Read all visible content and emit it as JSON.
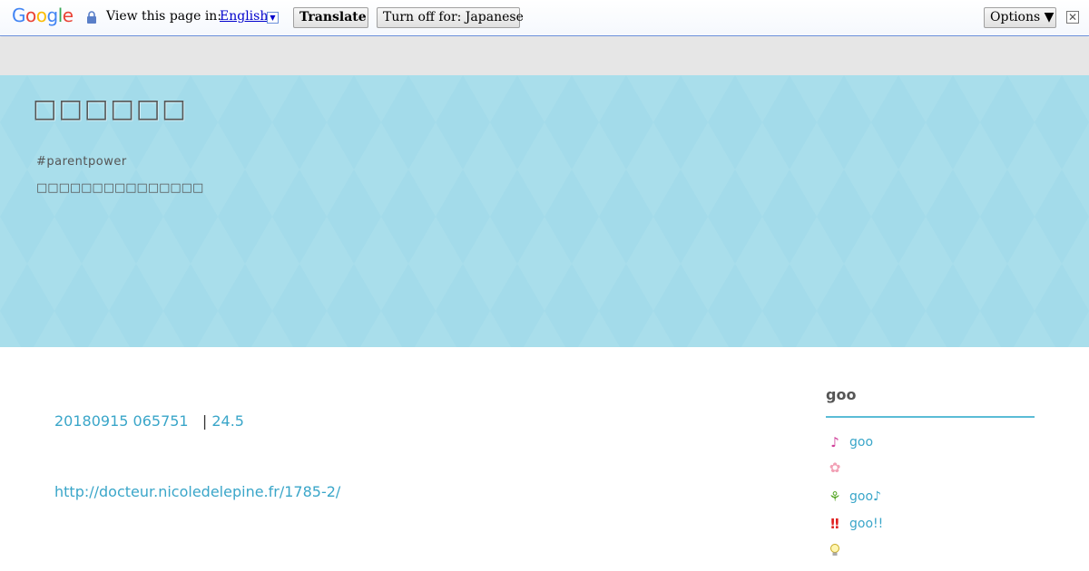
{
  "translate_bar": {
    "logo": "Google",
    "view_text": "View this page in:",
    "language": "English",
    "translate_label": "Translate",
    "turn_off_label": "Turn off for: Japanese",
    "options_label": "Options ▼",
    "close_glyph": "✕"
  },
  "header": {
    "title": "□□□□□□",
    "tag": "#parentpower",
    "description": "□□□□□□□□□□□□□□□"
  },
  "post": {
    "date": "20180915 065751",
    "separator": "|",
    "category": "24.5",
    "link": "http://docteur.nicoledelepine.fr/1785-2/"
  },
  "sidebar": {
    "title": "goo",
    "items": [
      {
        "icon": "music-note-icon",
        "glyph": "♪",
        "color": "#d0409a",
        "label": "goo"
      },
      {
        "icon": "flower-icon",
        "glyph": "✿",
        "color": "#f2a0b5",
        "label": ""
      },
      {
        "icon": "sprout-icon",
        "glyph": "⚘",
        "color": "#5aa82c",
        "label": "goo♪"
      },
      {
        "icon": "double-exclamation-icon",
        "glyph": "‼",
        "color": "#e02020",
        "label": "goo!!"
      },
      {
        "icon": "lightbulb-icon",
        "glyph": "💡",
        "color": "#d8b820",
        "label": ""
      }
    ]
  },
  "colors": {
    "header_bg": "#a3dbea",
    "link": "#3aa6c9",
    "accent_rule": "#5bbcd6"
  }
}
